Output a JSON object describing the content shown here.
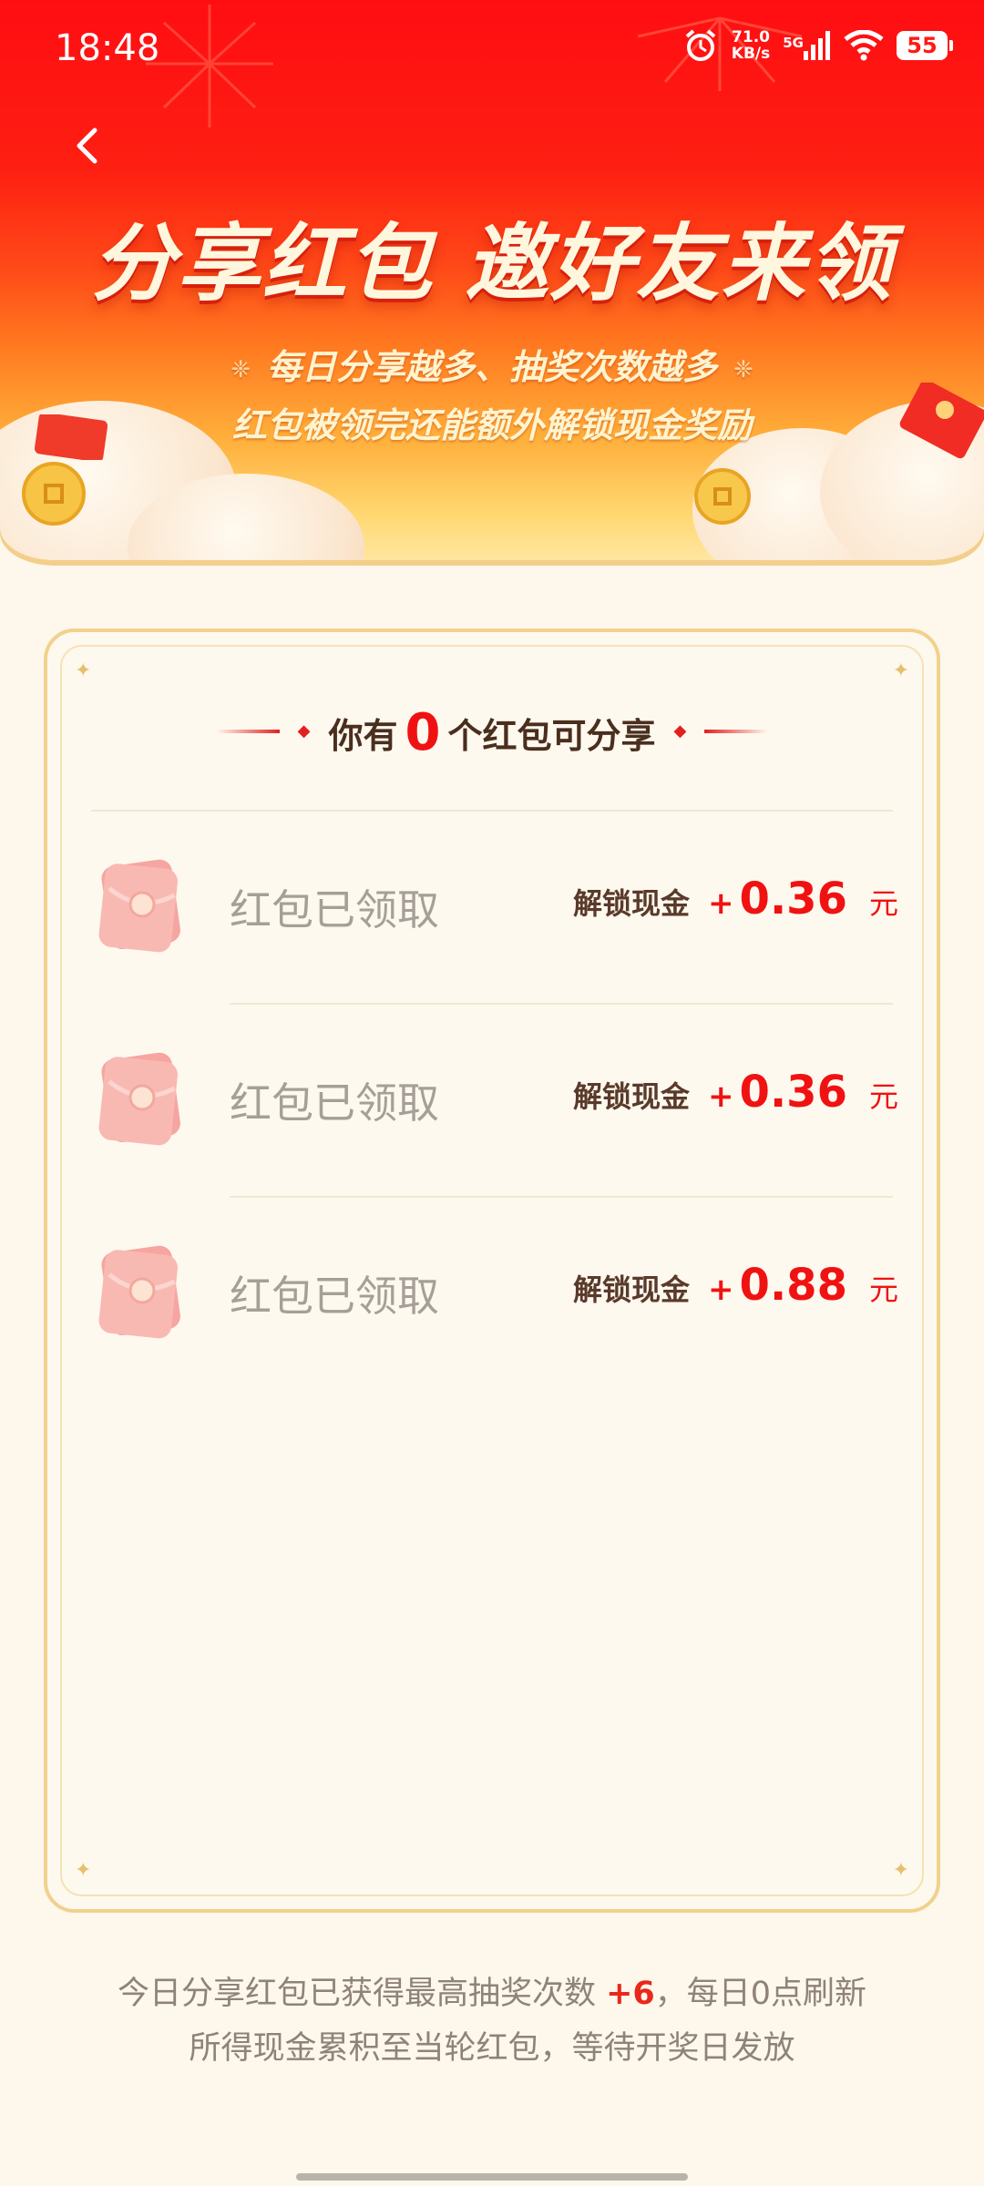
{
  "status_bar": {
    "time": "18:48",
    "net_speed_value": "71.0",
    "net_speed_unit": "KB/s",
    "network": "5G",
    "battery": "55"
  },
  "header": {
    "title": "分享红包 邀好友来领",
    "subtitle_line1": "每日分享越多、抽奖次数越多",
    "subtitle_line2": "红包被领完还能额外解锁现金奖励"
  },
  "card": {
    "header_prefix": "你有",
    "count": "0",
    "header_suffix": "个红包可分享",
    "rows": [
      {
        "status": "红包已领取",
        "cash_label": "解锁现金",
        "plus": "+",
        "amount": "0.36",
        "unit": "元"
      },
      {
        "status": "红包已领取",
        "cash_label": "解锁现金",
        "plus": "+",
        "amount": "0.36",
        "unit": "元"
      },
      {
        "status": "红包已领取",
        "cash_label": "解锁现金",
        "plus": "+",
        "amount": "0.88",
        "unit": "元"
      }
    ]
  },
  "footer": {
    "line1_prefix": "今日分享红包已获得最高抽奖次数",
    "line1_highlight": "+6",
    "line1_suffix": "，每日0点刷新",
    "line2": "所得现金累积至当轮红包，等待开奖日发放"
  },
  "colors": {
    "accent_red": "#f01212",
    "banner_top": "#ff0d12",
    "card_border": "#f1d18c",
    "page_bg": "#fdf7ec"
  },
  "icons": [
    "back-arrow-icon",
    "alarm-icon",
    "signal-icon",
    "wifi-icon",
    "battery-icon",
    "red-packet-icon",
    "sparkle-icon"
  ]
}
